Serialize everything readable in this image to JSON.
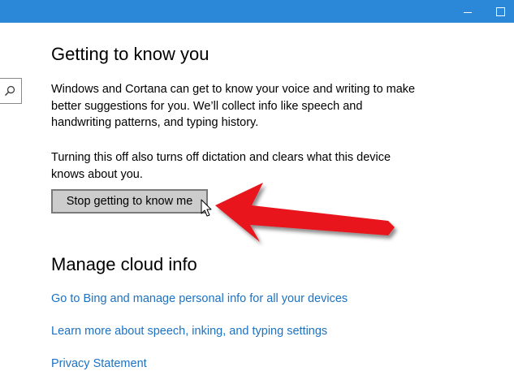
{
  "window": {
    "accent_color": "#2b88d8",
    "controls": [
      "minimize-icon",
      "maximize-icon"
    ]
  },
  "search": {
    "icon": "search-icon"
  },
  "sections": {
    "getting_to_know_you": {
      "heading": "Getting to know you",
      "description": "Windows and Cortana can get to know your voice and writing to make better suggestions for you. We’ll collect info like speech and handwriting patterns, and typing history.",
      "warning": "Turning this off also turns off dictation and clears what this device knows about you.",
      "button_label": "Stop getting to know me"
    },
    "manage_cloud_info": {
      "heading": "Manage cloud info",
      "links": [
        "Go to Bing and manage personal info for all your devices",
        "Learn more about speech, inking, and typing settings",
        "Privacy Statement"
      ]
    }
  },
  "colors": {
    "link": "#1c72c4",
    "button_bg": "#cccccc",
    "annotation_arrow": "#e8141b"
  },
  "annotation": {
    "type": "arrow",
    "icon": "red-arrow-icon",
    "pointer": "mouse-cursor-icon"
  }
}
